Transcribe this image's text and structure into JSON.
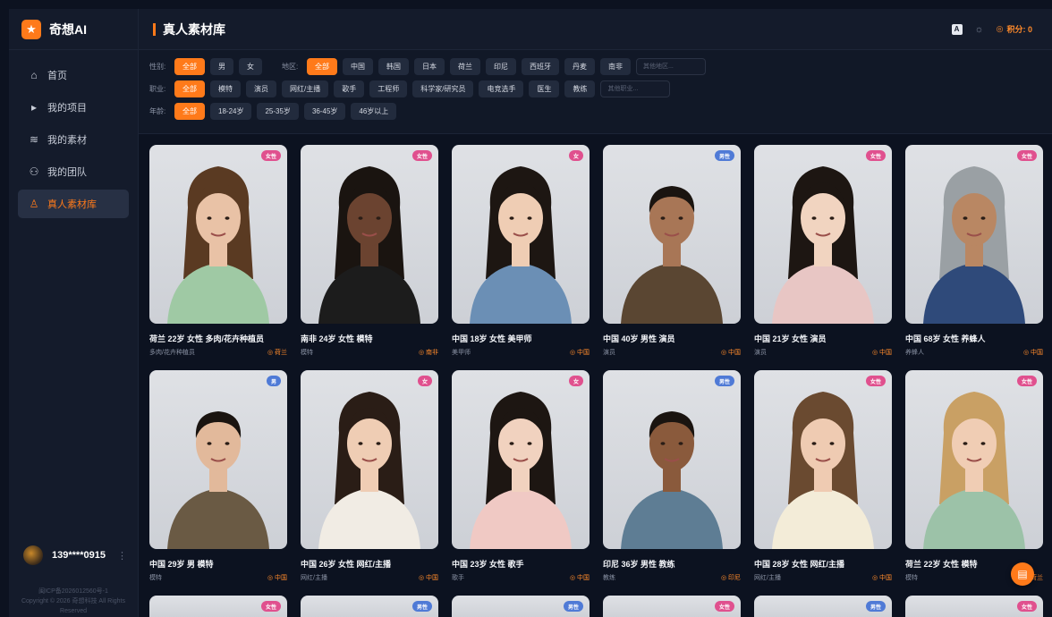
{
  "app": {
    "name": "奇想AI",
    "logo_icon": "star-icon",
    "accent": "#ff7a1a"
  },
  "nav": [
    {
      "label": "首页",
      "icon": "home-icon"
    },
    {
      "label": "我的项目",
      "icon": "folder-play-icon"
    },
    {
      "label": "我的素材",
      "icon": "database-icon"
    },
    {
      "label": "我的团队",
      "icon": "team-icon"
    },
    {
      "label": "真人素材库",
      "icon": "person-icon",
      "active": true
    }
  ],
  "user": {
    "name": "139****0915"
  },
  "footer": {
    "icp": "闽ICP备2026012560号-1",
    "copyright": "Copyright © 2026 奇想科技 All Rights Reserved"
  },
  "header": {
    "title": "真人素材库",
    "translate_label": "A",
    "points_label": "积分: 0"
  },
  "filters": {
    "gender": {
      "label": "性别:",
      "options": [
        "全部",
        "男",
        "女"
      ]
    },
    "region": {
      "label": "地区:",
      "options": [
        "全部",
        "中国",
        "韩国",
        "日本",
        "荷兰",
        "印尼",
        "西班牙",
        "丹麦",
        "南非"
      ],
      "placeholder": "其他地区..."
    },
    "job": {
      "label": "职业:",
      "options": [
        "全部",
        "模特",
        "演员",
        "网红/主播",
        "歌手",
        "工程师",
        "科学家/研究员",
        "电竞选手",
        "医生",
        "教练"
      ],
      "placeholder": "其他职业..."
    },
    "age": {
      "label": "年龄:",
      "options": [
        "全部",
        "18-24岁",
        "25-35岁",
        "36-45岁",
        "46岁以上"
      ]
    }
  },
  "cards": [
    {
      "title": "荷兰 22岁 女性 多肉/花卉种植员",
      "job": "多肉/花卉种植员",
      "loc": "荷兰",
      "badge": "女性",
      "g": "f",
      "skin": "#e9c2a6",
      "hair": "#5a3a22",
      "shirt": "#9fc9a4"
    },
    {
      "title": "南非 24岁 女性 模特",
      "job": "模特",
      "loc": "南非",
      "badge": "女性",
      "g": "f",
      "skin": "#6b4330",
      "hair": "#1a1410",
      "shirt": "#1c1c1c"
    },
    {
      "title": "中国 18岁 女性 美甲师",
      "job": "美甲师",
      "loc": "中国",
      "badge": "女",
      "g": "f",
      "skin": "#efcdb4",
      "hair": "#1d1612",
      "shirt": "#6b8fb5"
    },
    {
      "title": "中国 40岁 男性 演员",
      "job": "演员",
      "loc": "中国",
      "badge": "男性",
      "g": "m",
      "skin": "#a87656",
      "hair": "#1a1410",
      "shirt": "#5a4632"
    },
    {
      "title": "中国 21岁 女性 演员",
      "job": "演员",
      "loc": "中国",
      "badge": "女性",
      "g": "f",
      "skin": "#f1d4c0",
      "hair": "#1d1612",
      "shirt": "#e8c6c4"
    },
    {
      "title": "中国 68岁 女性 养蜂人",
      "job": "养蜂人",
      "loc": "中国",
      "badge": "女性",
      "g": "f",
      "skin": "#b98763",
      "hair": "#9aa0a4",
      "shirt": "#2f4a7a"
    },
    {
      "title": "中国 29岁 男 模特",
      "job": "模特",
      "loc": "中国",
      "badge": "男",
      "g": "m",
      "skin": "#e2b99b",
      "hair": "#1a1410",
      "shirt": "#6a5a44"
    },
    {
      "title": "中国 26岁 女性 网红/主播",
      "job": "网红/主播",
      "loc": "中国",
      "badge": "女",
      "g": "f",
      "skin": "#efcdb4",
      "hair": "#2a1d16",
      "shirt": "#f1ece4"
    },
    {
      "title": "中国 23岁 女性 歌手",
      "job": "歌手",
      "loc": "中国",
      "badge": "女",
      "g": "f",
      "skin": "#f1d2bf",
      "hair": "#1d1612",
      "shirt": "#f0c9c4"
    },
    {
      "title": "印尼 36岁 男性 教练",
      "job": "教练",
      "loc": "印尼",
      "badge": "男性",
      "g": "m",
      "skin": "#8a5a3c",
      "hair": "#1a1410",
      "shirt": "#5e7d94"
    },
    {
      "title": "中国 28岁 女性 网红/主播",
      "job": "网红/主播",
      "loc": "中国",
      "badge": "女性",
      "g": "f",
      "skin": "#efcbb2",
      "hair": "#6a4a30",
      "shirt": "#f3ecd8"
    },
    {
      "title": "荷兰 22岁 女性 模特",
      "job": "模特",
      "loc": "荷兰",
      "badge": "女性",
      "g": "f",
      "skin": "#f0cdb4",
      "hair": "#c9a064",
      "shirt": "#9cc2a8"
    }
  ],
  "row3_badges": [
    {
      "badge": "女性",
      "g": "f"
    },
    {
      "badge": "男性",
      "g": "m"
    },
    {
      "badge": "男性",
      "g": "m"
    },
    {
      "badge": "女性",
      "g": "f"
    },
    {
      "badge": "男性",
      "g": "m"
    },
    {
      "badge": "女性",
      "g": "f"
    }
  ]
}
